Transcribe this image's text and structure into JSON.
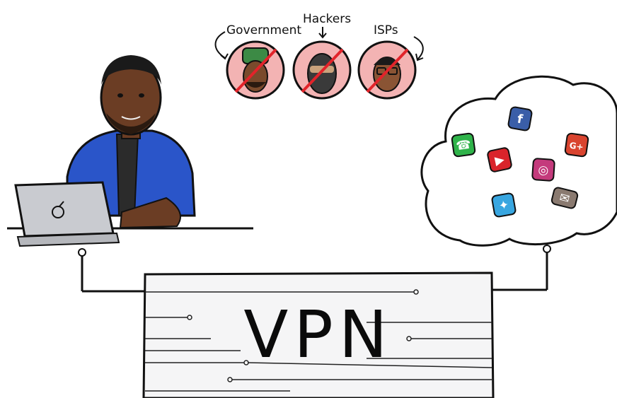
{
  "threats": [
    {
      "label": "Government",
      "icon": "government-face-icon"
    },
    {
      "label": "Hackers",
      "icon": "hacker-face-icon"
    },
    {
      "label": "ISPs",
      "icon": "isp-face-icon"
    }
  ],
  "vpn": {
    "label": "VPN"
  },
  "cloud_apps": [
    {
      "name": "whatsapp-icon",
      "color": "#2fb34a",
      "glyph": "☎"
    },
    {
      "name": "facebook-icon",
      "color": "#3a5ea8",
      "glyph": "f"
    },
    {
      "name": "youtube-icon",
      "color": "#d9242b",
      "glyph": "▶"
    },
    {
      "name": "google-plus-icon",
      "color": "#d9442f",
      "glyph": "G+"
    },
    {
      "name": "instagram-icon",
      "color": "#c43a7c",
      "glyph": "◎"
    },
    {
      "name": "twitter-icon",
      "color": "#38a6e0",
      "glyph": "✦"
    },
    {
      "name": "mail-icon",
      "color": "#8a7a70",
      "glyph": "✉"
    }
  ],
  "colors": {
    "threat_circle": "#f3b3b3",
    "strike": "#e2232a",
    "shirt": "#2a55c9",
    "skin": "#6b3d24",
    "laptop": "#c9cbd0"
  }
}
